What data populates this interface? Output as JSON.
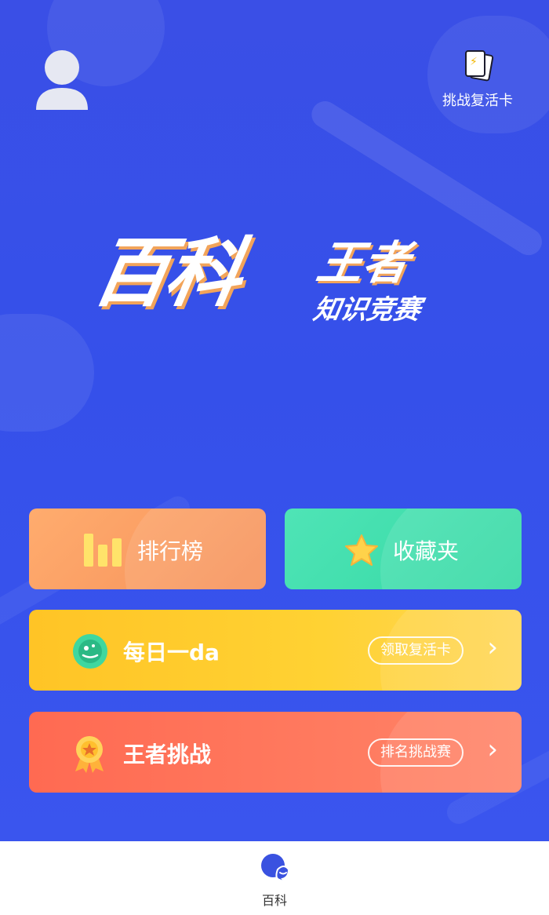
{
  "header": {
    "revive_card_label": "挑战复活卡"
  },
  "logo": {
    "title_main": "百科",
    "title_king": "王者",
    "subtitle": "知识竞赛"
  },
  "menu": {
    "leaderboard_label": "排行榜",
    "favorites_label": "收藏夹",
    "daily": {
      "label": "每日一da",
      "pill": "领取复活卡"
    },
    "king_challenge": {
      "label": "王者挑战",
      "pill": "排名挑战赛"
    }
  },
  "tabbar": {
    "items": [
      {
        "label": "百科",
        "icon": "chat-bubble-icon"
      }
    ]
  },
  "colors": {
    "background": "#3a4fe6",
    "leaderboard": "#f6915a",
    "favorites": "#34d9a4",
    "daily": "#ffc426",
    "king_challenge": "#ff6a52",
    "tab_active": "#3a52e0"
  }
}
